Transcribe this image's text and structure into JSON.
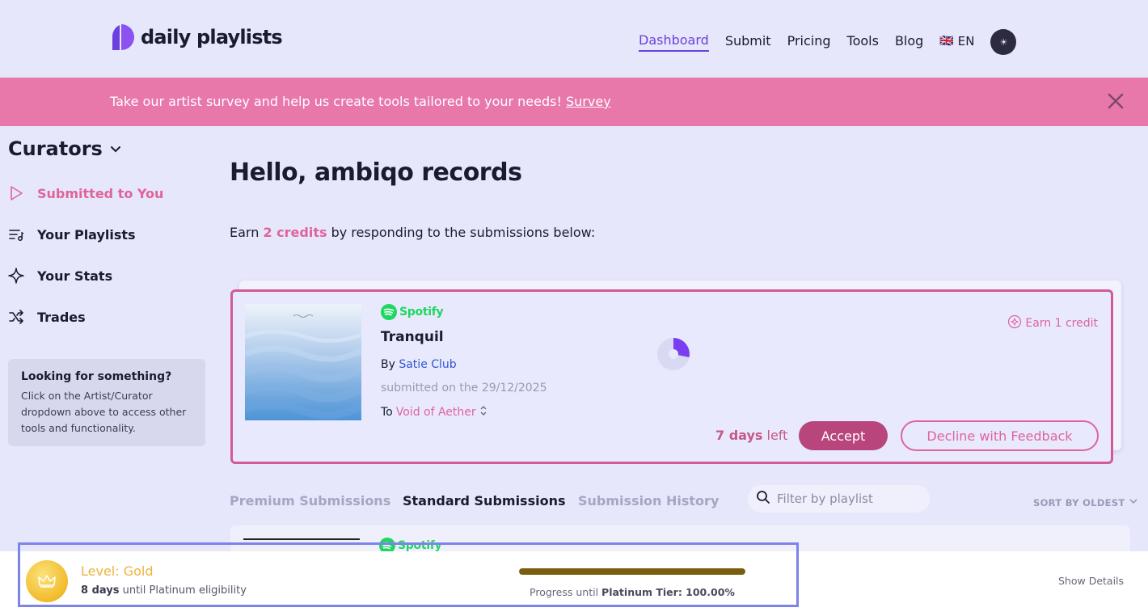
{
  "header": {
    "logo_text": "daily playlists",
    "nav": [
      {
        "label": "Dashboard",
        "active": true
      },
      {
        "label": "Submit"
      },
      {
        "label": "Pricing"
      },
      {
        "label": "Tools"
      },
      {
        "label": "Blog"
      }
    ],
    "language": "EN",
    "language_flag": "🇬🇧",
    "theme_icon": "sun-icon"
  },
  "banner": {
    "text": "Take our artist survey and help us create tools tailored to your needs!",
    "link": "Survey",
    "close_icon": "close-icon",
    "color": "#e877aa"
  },
  "sidebar": {
    "title": "Curators",
    "items": [
      {
        "label": "Submitted to You",
        "icon": "play-icon",
        "active": true
      },
      {
        "label": "Your Playlists",
        "icon": "playlist-icon"
      },
      {
        "label": "Your Stats",
        "icon": "sparkle-icon"
      },
      {
        "label": "Trades",
        "icon": "shuffle-icon"
      }
    ],
    "help": {
      "title": "Looking for something?",
      "text": "Click on the Artist/Curator dropdown above to access other tools and functionality."
    }
  },
  "main": {
    "greeting": "Hello, ambiqo records",
    "earn_prefix": "Earn",
    "earn_credits": "2 credits",
    "earn_suffix": "by responding to the submissions below:",
    "submission": {
      "platform": "Spotify",
      "title": "Tranquil",
      "by_label": "By",
      "artist": "Satie Club",
      "submitted_label": "submitted on the",
      "submitted_date": "29/12/2025",
      "to_label": "To",
      "playlist": "Void of Aether",
      "earn_credit": "Earn 1 credit",
      "days": "7 days",
      "days_suffix": "left",
      "accept_label": "Accept",
      "decline_label": "Decline with Feedback"
    },
    "tabs": [
      {
        "label": "Premium Submissions"
      },
      {
        "label": "Standard Submissions",
        "active": true
      },
      {
        "label": "Submission History"
      }
    ],
    "filter_placeholder": "Filter by playlist",
    "sort_label": "SORT BY OLDEST",
    "next_platform": "Spotify"
  },
  "level_bar": {
    "level": "Level: Gold",
    "days": "8 days",
    "days_suffix": "until Platinum eligibility",
    "progress_label": "Progress until",
    "progress_tier": "Platinum Tier: 100.00%",
    "progress": 1.0,
    "show_details": "Show Details"
  },
  "colors": {
    "accent": "#6d3fe0",
    "pink": "#e0649c",
    "spotify": "#1ed760"
  }
}
